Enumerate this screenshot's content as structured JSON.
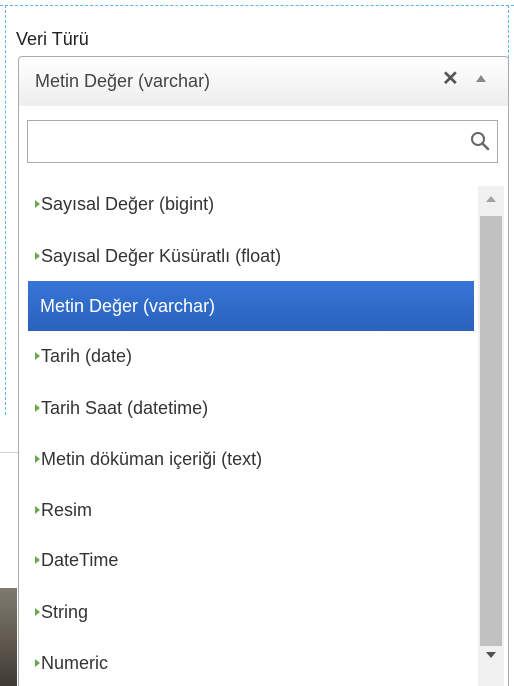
{
  "field": {
    "label": "Veri Türü",
    "selected_value": "Metin Değer (varchar)",
    "clear_symbol": "✕"
  },
  "search": {
    "value": "",
    "placeholder": ""
  },
  "options": [
    {
      "label": "Sayısal Değer (bigint)",
      "highlighted": false
    },
    {
      "label": "Sayısal Değer Küsüratlı (float)",
      "highlighted": false
    },
    {
      "label": "Metin Değer (varchar)",
      "highlighted": true
    },
    {
      "label": "Tarih (date)",
      "highlighted": false
    },
    {
      "label": "Tarih Saat (datetime)",
      "highlighted": false
    },
    {
      "label": "Metin döküman içeriği (text)",
      "highlighted": false
    },
    {
      "label": "Resim",
      "highlighted": false
    },
    {
      "label": "DateTime",
      "highlighted": false
    },
    {
      "label": "String",
      "highlighted": false
    },
    {
      "label": "Numeric",
      "highlighted": false
    }
  ],
  "colors": {
    "highlight": "#3875d7",
    "bullet": "#6aa84f",
    "guide_dash": "#5bb8e0"
  },
  "icons": {
    "clear": "close-icon",
    "toggle": "arrow-up-icon",
    "search": "search-icon",
    "bullet": "triangle-right-icon"
  }
}
